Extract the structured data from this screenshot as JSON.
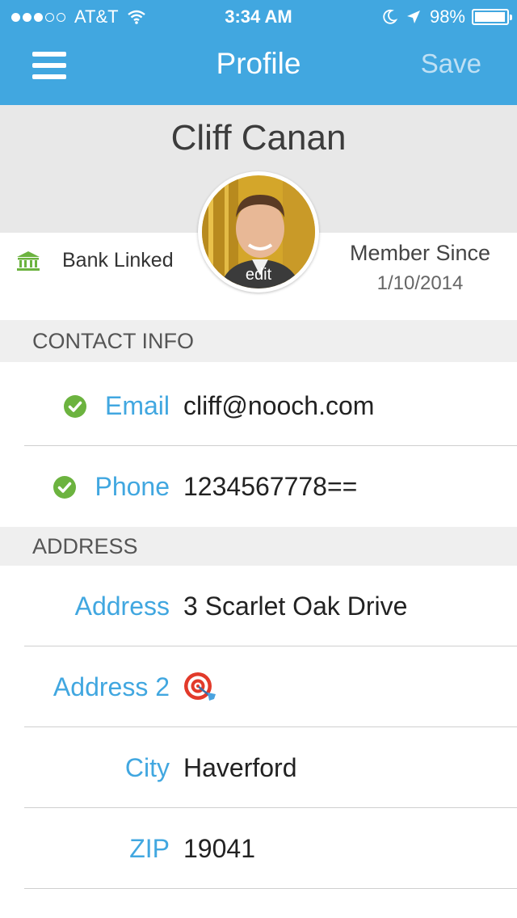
{
  "status_bar": {
    "carrier": "AT&T",
    "time": "3:34 AM",
    "battery_percent": "98%",
    "battery_level": 0.98,
    "signal_bars_filled": 3,
    "signal_bars_total": 5
  },
  "header": {
    "title": "Profile",
    "save_label": "Save",
    "menu_icon": "hamburger-menu-icon"
  },
  "profile": {
    "name": "Cliff Canan",
    "avatar_edit_label": "edit",
    "bank_status": "Bank Linked",
    "member_since_label": "Member Since",
    "member_since_date": "1/10/2014"
  },
  "contact_section": {
    "title": "CONTACT INFO",
    "email_label": "Email",
    "email_value": "cliff@nooch.com",
    "phone_label": "Phone",
    "phone_value": "1234567778=="
  },
  "address_section": {
    "title": "ADDRESS",
    "address_label": "Address",
    "address_value": "3 Scarlet Oak Drive",
    "address2_label": "Address 2",
    "city_label": "City",
    "city_value": "Haverford",
    "zip_label": "ZIP",
    "zip_value": "19041"
  },
  "colors": {
    "header_blue": "#41a7e0",
    "verified_green": "#6cb33f",
    "section_gray": "#efefef"
  }
}
